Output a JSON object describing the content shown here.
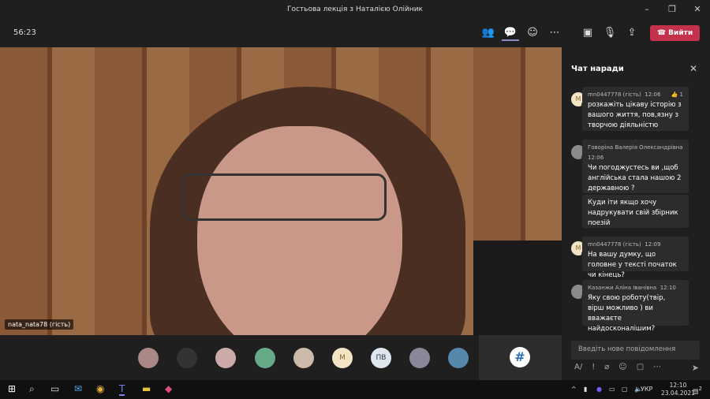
{
  "window": {
    "title": "Гостьова лекція з Наталією Олійник"
  },
  "toolbar": {
    "timer": "56:23",
    "leave_label": "Вийти",
    "leave_color": "#c4314b"
  },
  "video": {
    "participant_name": "nata_nata78 (гість)"
  },
  "participants": [
    "",
    "",
    "",
    "",
    "",
    "M",
    "ПВ",
    "",
    ""
  ],
  "tile_logo": "#",
  "chat": {
    "title": "Чат наради",
    "messages": [
      {
        "author": "mn0447778 (гість)",
        "time": "12:06",
        "initial": "M",
        "reaction": "👍 1",
        "texts": [
          "розкажіть цікаву історію з вашого життя, пов,язну з творчою діяльністю"
        ]
      },
      {
        "author": "Говоріна Валерія Олександрівна",
        "time": "12:06",
        "texts": [
          "Чи погоджустесь ви ,щоб англійська стала нашою 2 державною ?",
          "Куди іти якщо хочу надрукувати свій збірник поезій"
        ]
      },
      {
        "author": "mn0447778 (гість)",
        "time": "12:09",
        "initial": "M",
        "texts": [
          " На вашу думку, що головне у тексті початок чи кінець?"
        ]
      },
      {
        "author": "Казанжи Аліна Іванівна",
        "time": "12:10",
        "texts": [
          "Яку свою роботу(твір, вірш можливо ) ви вважаєте найдосконалішим?"
        ]
      }
    ],
    "compose_placeholder": "Введіть нове повідомлення"
  },
  "taskbar": {
    "language": "УКР",
    "time": "12:10",
    "date": "23.04.2021",
    "notifications": "2"
  }
}
